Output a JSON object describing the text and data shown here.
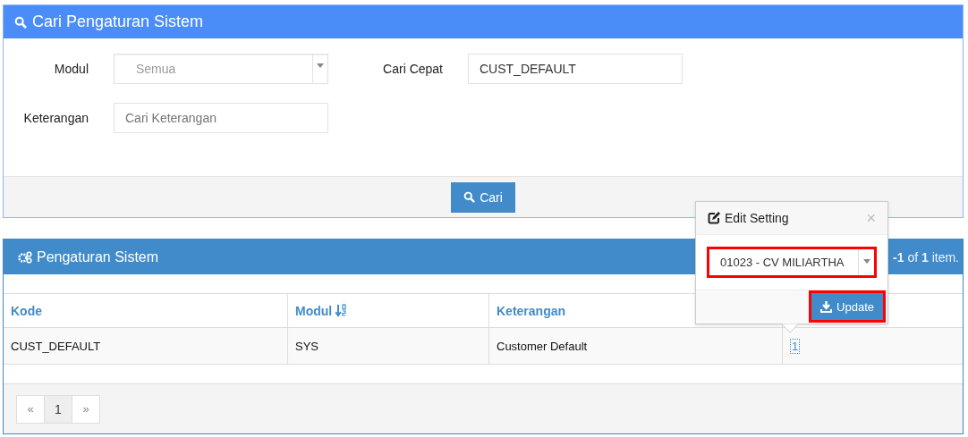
{
  "search_panel": {
    "title": "Cari Pengaturan Sistem",
    "fields": [
      {
        "label": "Modul",
        "kind": "select",
        "value": "Semua"
      },
      {
        "label": "Cari Cepat",
        "kind": "text",
        "value": "CUST_DEFAULT"
      },
      {
        "label": "Keterangan",
        "kind": "text",
        "placeholder": "Cari Keterangan"
      }
    ],
    "button": "Cari"
  },
  "results_panel": {
    "title": "Pengaturan Sistem",
    "summary": "**-1** of **1** item.",
    "table": {
      "columns": [
        {
          "label": "Kode",
          "sorted": false
        },
        {
          "label": "Modul",
          "sorted": true
        },
        {
          "label": "Keterangan",
          "sorted": false
        }
      ],
      "rows": [
        {
          "kode": "CUST_DEFAULT",
          "modul": "SYS",
          "keterangan": "Customer Default",
          "value": "1"
        }
      ]
    },
    "pagination": [
      {
        "label": "«",
        "selected": false
      },
      {
        "label": "1",
        "selected": true
      },
      {
        "label": "»",
        "selected": false
      }
    ]
  },
  "popover": {
    "title": "Edit Setting",
    "close": "×",
    "select": {
      "value": "01023 - CV MILIARTHA",
      "highlighted": true
    },
    "button": {
      "label": "Update",
      "highlighted": true
    }
  }
}
